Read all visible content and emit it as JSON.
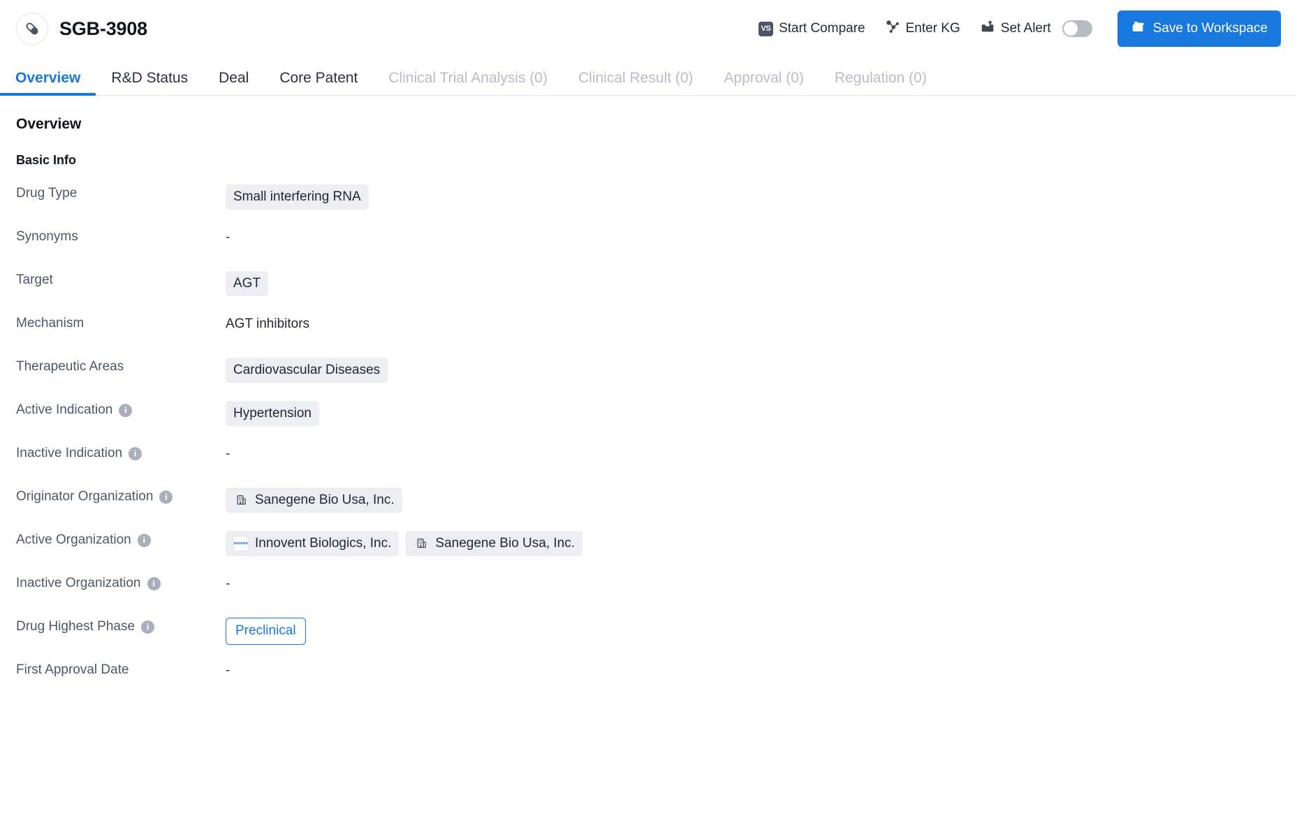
{
  "header": {
    "drug_icon": "capsule-icon",
    "title": "SGB-3908",
    "actions": [
      {
        "id": "start-compare",
        "label": "Start Compare",
        "icon": "vs-badge-icon",
        "badge_text": "VS"
      },
      {
        "id": "enter-kg",
        "label": "Enter KG",
        "icon": "knowledge-graph-icon"
      },
      {
        "id": "set-alert",
        "label": "Set Alert",
        "icon": "alert-inbox-icon",
        "toggle_state": "off"
      }
    ],
    "save_button": {
      "label": "Save to Workspace",
      "icon": "folder-icon",
      "color": "#1878dd"
    }
  },
  "tabs": [
    {
      "label": "Overview",
      "state": "active"
    },
    {
      "label": "R&D Status",
      "state": "enabled"
    },
    {
      "label": "Deal",
      "state": "enabled"
    },
    {
      "label": "Core Patent",
      "state": "enabled"
    },
    {
      "label": "Clinical Trial Analysis (0)",
      "state": "disabled"
    },
    {
      "label": "Clinical Result (0)",
      "state": "disabled"
    },
    {
      "label": "Approval (0)",
      "state": "disabled"
    },
    {
      "label": "Regulation (0)",
      "state": "disabled"
    }
  ],
  "overview": {
    "section_title": "Overview",
    "subsection_title": "Basic Info",
    "fields": [
      {
        "label": "Drug Type",
        "has_info": false,
        "type": "chips",
        "values": [
          {
            "text": "Small interfering RNA"
          }
        ]
      },
      {
        "label": "Synonyms",
        "has_info": false,
        "type": "empty",
        "values": [
          {
            "text": "-"
          }
        ]
      },
      {
        "label": "Target",
        "has_info": false,
        "type": "chips",
        "values": [
          {
            "text": "AGT"
          }
        ]
      },
      {
        "label": "Mechanism",
        "has_info": false,
        "type": "plain",
        "values": [
          {
            "text": "AGT inhibitors"
          }
        ]
      },
      {
        "label": "Therapeutic Areas",
        "has_info": false,
        "type": "chips",
        "values": [
          {
            "text": "Cardiovascular Diseases"
          }
        ]
      },
      {
        "label": "Active Indication",
        "has_info": true,
        "type": "chips",
        "values": [
          {
            "text": "Hypertension"
          }
        ]
      },
      {
        "label": "Inactive Indication",
        "has_info": true,
        "type": "empty",
        "values": [
          {
            "text": "-"
          }
        ]
      },
      {
        "label": "Originator Organization",
        "has_info": true,
        "type": "org-chips",
        "values": [
          {
            "text": "Sanegene Bio Usa, Inc.",
            "logo": "building-icon"
          }
        ]
      },
      {
        "label": "Active Organization",
        "has_info": true,
        "type": "org-chips",
        "values": [
          {
            "text": "Innovent Biologics, Inc.",
            "logo": "innovent-logo",
            "logo_text": "innovent"
          },
          {
            "text": "Sanegene Bio Usa, Inc.",
            "logo": "building-icon"
          }
        ]
      },
      {
        "label": "Inactive Organization",
        "has_info": true,
        "type": "empty",
        "values": [
          {
            "text": "-"
          }
        ]
      },
      {
        "label": "Drug Highest Phase",
        "has_info": true,
        "type": "phase",
        "values": [
          {
            "text": "Preclinical"
          }
        ]
      },
      {
        "label": "First Approval Date",
        "has_info": false,
        "type": "empty",
        "values": [
          {
            "text": "-"
          }
        ]
      }
    ]
  }
}
